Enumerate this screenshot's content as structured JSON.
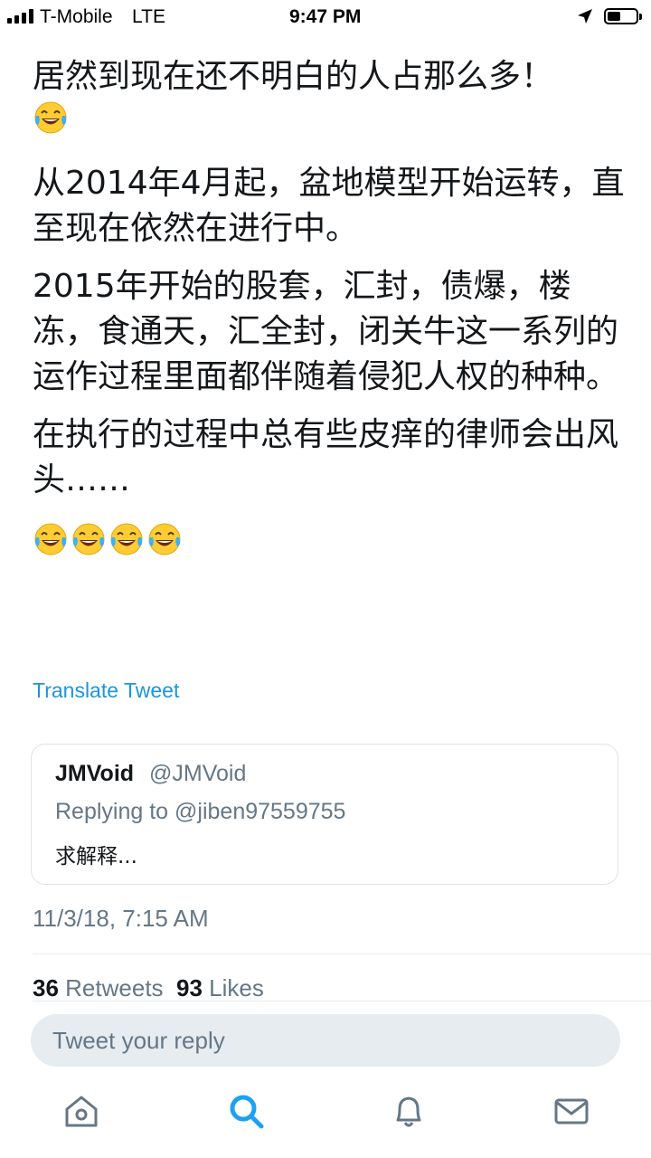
{
  "status_bar": {
    "carrier": "T-Mobile",
    "network": "LTE",
    "time": "9:47 PM"
  },
  "tweet": {
    "paragraphs": [
      "居然到现在还不明白的人占那么多！",
      "从2014年4月起，盆地模型开始运转，直至现在依然在进行中。",
      "2015年开始的股套，汇封，债爆，楼冻，食通天，汇全封，闭关牛这一系列的运作过程里面都伴随着侵犯人权的种种。",
      "在执行的过程中总有些皮痒的律师会出风头……"
    ],
    "emoji_name": "face-with-tears-of-joy",
    "translate_label": "Translate Tweet"
  },
  "quoted_tweet": {
    "name": "JMVoid",
    "handle": "@JMVoid",
    "replying_to": "Replying to @jiben97559755",
    "text": "求解释..."
  },
  "timestamp": "11/3/18, 7:15 AM",
  "stats": {
    "retweets": "36",
    "retweets_label": "Retweets",
    "likes": "93",
    "likes_label": "Likes"
  },
  "reply_box": {
    "placeholder": "Tweet your reply"
  },
  "tabbar": {
    "active_color": "#1da1f2",
    "inactive_color": "#657786",
    "icons": [
      "home-icon",
      "search-icon",
      "notifications-icon",
      "messages-icon"
    ]
  }
}
